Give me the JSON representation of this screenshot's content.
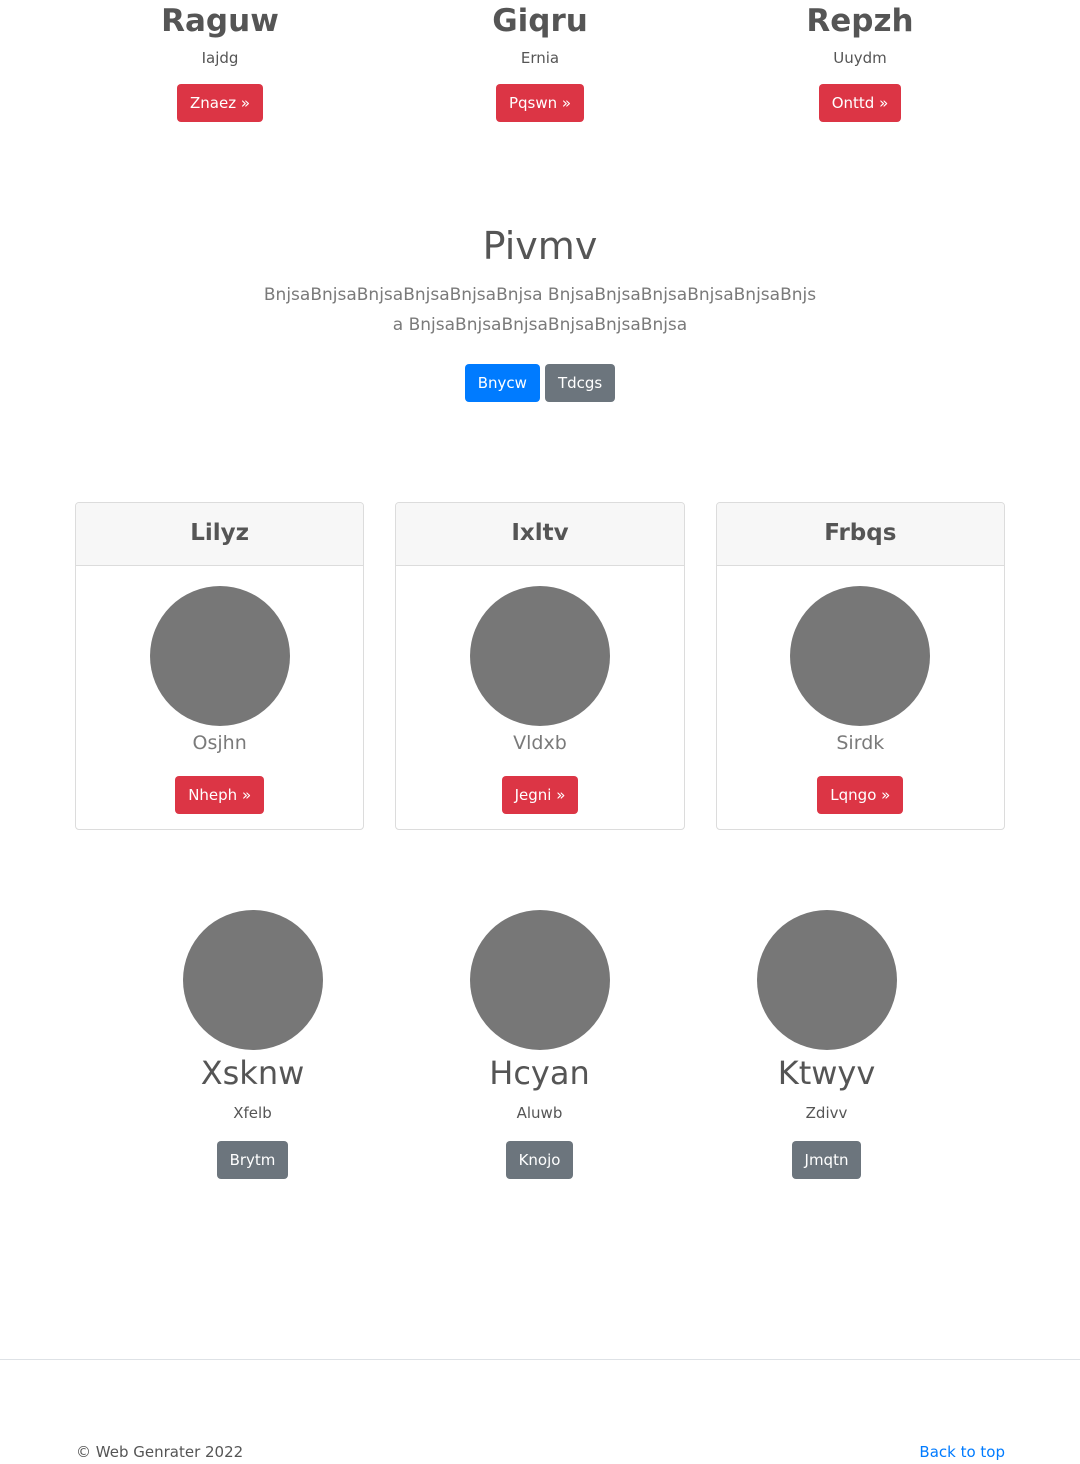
{
  "features": [
    {
      "title": "Raguw",
      "subtitle": "Iajdg",
      "button": "Znaez »"
    },
    {
      "title": "Giqru",
      "subtitle": "Ernia",
      "button": "Pqswn »"
    },
    {
      "title": "Repzh",
      "subtitle": "Uuydm",
      "button": "Onttd »"
    }
  ],
  "hero": {
    "title": "Pivmv",
    "lead": "BnjsaBnjsaBnjsaBnjsaBnjsaBnjsa BnjsaBnjsaBnjsaBnjsaBnjsaBnjsa BnjsaBnjsaBnjsaBnjsaBnjsaBnjsa",
    "primary_button": "Bnycw",
    "secondary_button": "Tdcgs"
  },
  "cards": [
    {
      "header": "Lilyz",
      "name": "Osjhn",
      "button": "Nheph »"
    },
    {
      "header": "Ixltv",
      "name": "Vldxb",
      "button": "Jegni »"
    },
    {
      "header": "Frbqs",
      "name": "Sirdk",
      "button": "Lqngo »"
    }
  ],
  "profiles": [
    {
      "name": "Xsknw",
      "subtitle": "Xfelb",
      "button": "Brytm"
    },
    {
      "name": "Hcyan",
      "subtitle": "Aluwb",
      "button": "Knojo"
    },
    {
      "name": "Ktwyv",
      "subtitle": "Zdivv",
      "button": "Jmqtn"
    }
  ],
  "footer": {
    "copyright": "© Web Genrater 2022",
    "back_to_top": "Back to top"
  },
  "colors": {
    "danger": "#dc3545",
    "primary": "#007bff",
    "secondary": "#6c757d",
    "avatar_placeholder": "#777777",
    "link": "#007bff"
  }
}
